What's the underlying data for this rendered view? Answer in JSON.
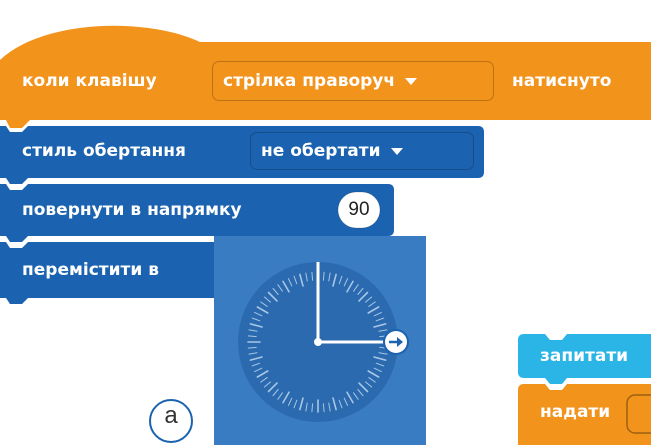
{
  "colors": {
    "events": "#F2931C",
    "motion": "#1B63B0",
    "sensing": "#2BB5E6",
    "dial_bg": "#3A7CC2",
    "dial_face": "#2B6AAE",
    "ticks": "#A8C6E6"
  },
  "blocks": {
    "hat": {
      "prefix": "коли клавішу",
      "key_option": "стрілка праворуч",
      "suffix": "натиснуто"
    },
    "rotation_style": {
      "label": "стиль обертання",
      "option": "не обертати"
    },
    "point_direction": {
      "label": "повернути в напрямку",
      "value": "90"
    },
    "go_to": {
      "label": "перемістити в"
    },
    "ask": {
      "label": "запитати"
    },
    "set": {
      "label": "надати"
    }
  },
  "direction_dial": {
    "value": 90,
    "icon": "arrow-right-icon"
  },
  "caption": "а"
}
